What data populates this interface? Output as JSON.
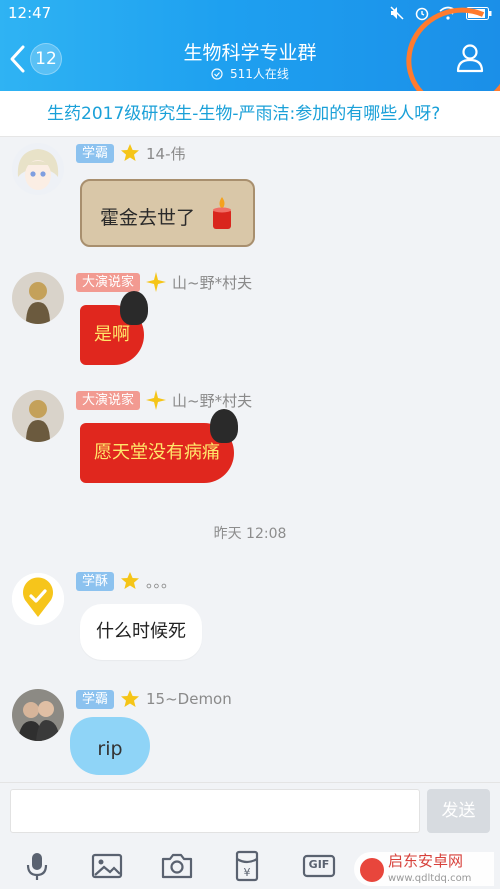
{
  "status_bar": {
    "time": "12:47"
  },
  "header": {
    "back_badge": "12",
    "title": "生物科学专业群",
    "online": "511人在线"
  },
  "notice": {
    "text": "生药2017级研究生-生物-严雨洁:参加的有哪些人呀?"
  },
  "messages": [
    {
      "tag": "学霸",
      "tag_color": "#8cc2ef",
      "name": "14-伟",
      "text": "霍金去世了"
    },
    {
      "tag": "大演说家",
      "tag_color": "#f29a91",
      "name": "山~野*村夫",
      "text": "是啊"
    },
    {
      "tag": "大演说家",
      "tag_color": "#f29a91",
      "name": "山~野*村夫",
      "text": "愿天堂没有病痛"
    },
    {
      "tag": "学酥",
      "tag_color": "#8cc2ef",
      "name": "。。。",
      "text": "什么时候死"
    },
    {
      "tag": "学霸",
      "tag_color": "#8cc2ef",
      "name": "15~Demon",
      "text": "rip"
    }
  ],
  "timestamp": "昨天 12:08",
  "input": {
    "send_label": "发送"
  },
  "toolbar": {
    "icons": [
      "microphone-icon",
      "image-icon",
      "camera-icon",
      "red-packet-icon",
      "gif-icon"
    ],
    "gif_label": "GIF"
  },
  "watermark": {
    "title": "启东安卓网",
    "url": "www.qdltdq.com"
  },
  "colors": {
    "accent": "#1ea0f0",
    "notice_text": "#1aa0d8",
    "annotation": "#ff7b2e"
  }
}
